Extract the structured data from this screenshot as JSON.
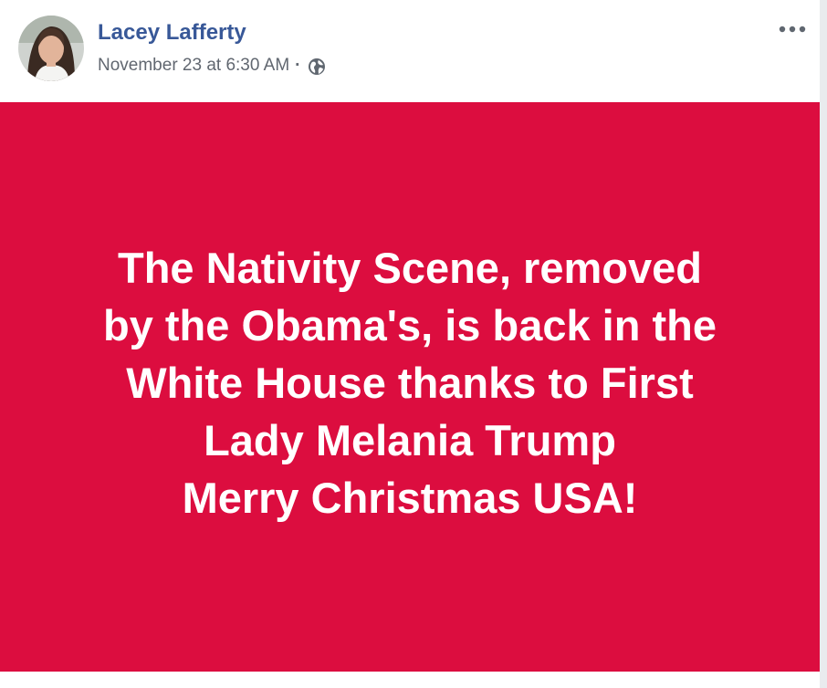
{
  "post": {
    "author": {
      "name": "Lacey Lafferty",
      "avatar_icon": "profile-photo"
    },
    "timestamp": "November 23 at 6:30 AM",
    "separator": "·",
    "privacy_icon": "globe-icon",
    "more_icon": "more-options-icon",
    "body": {
      "background_color": "#dc0d3f",
      "text_color": "#ffffff",
      "text": "The Nativity Scene, removed\nby the Obama's, is back in the\nWhite House thanks to First\nLady Melania Trump\nMerry Christmas USA!"
    }
  },
  "colors": {
    "author_link": "#385898",
    "meta_text": "#616770",
    "page_background": "#e9ebee"
  }
}
